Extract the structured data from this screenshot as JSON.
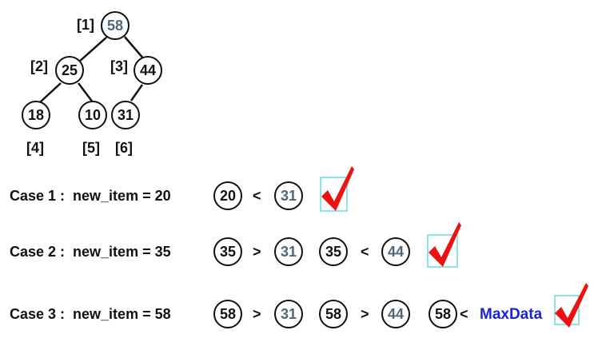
{
  "tree": {
    "nodes": [
      {
        "value": "58",
        "index": "[1]",
        "tone": "gray"
      },
      {
        "value": "25",
        "index": "[2]",
        "tone": "dark"
      },
      {
        "value": "44",
        "index": "[3]",
        "tone": "dark"
      },
      {
        "value": "18",
        "index": "[4]",
        "tone": "dark"
      },
      {
        "value": "10",
        "index": "[5]",
        "tone": "dark"
      },
      {
        "value": "31",
        "index": "[6]",
        "tone": "dark"
      }
    ]
  },
  "cases": [
    {
      "label": "Case 1 :  new_item = 20",
      "steps": [
        {
          "v": "20",
          "tone": "dark"
        },
        {
          "op": "<"
        },
        {
          "v": "31",
          "tone": "gray"
        }
      ]
    },
    {
      "label": "Case 2 :  new_item = 35",
      "steps": [
        {
          "v": "35",
          "tone": "dark"
        },
        {
          "op": ">"
        },
        {
          "v": "31",
          "tone": "gray"
        },
        {
          "v": "35",
          "tone": "dark"
        },
        {
          "op": "<"
        },
        {
          "v": "44",
          "tone": "gray"
        }
      ]
    },
    {
      "label": "Case 3 :  new_item = 58",
      "steps": [
        {
          "v": "58",
          "tone": "dark"
        },
        {
          "op": ">"
        },
        {
          "v": "31",
          "tone": "gray"
        },
        {
          "v": "58",
          "tone": "dark"
        },
        {
          "op": ">"
        },
        {
          "v": "44",
          "tone": "gray"
        },
        {
          "v": "58",
          "tone": "dark"
        },
        {
          "op": "<"
        }
      ],
      "maxdata": "MaxData"
    }
  ],
  "colors": {
    "check": "#ee1111",
    "check_box": "#66dddd",
    "maxdata": "#1a22dd",
    "gray_text": "#4f6677"
  },
  "icons": {
    "check": "check-mark-icon"
  }
}
